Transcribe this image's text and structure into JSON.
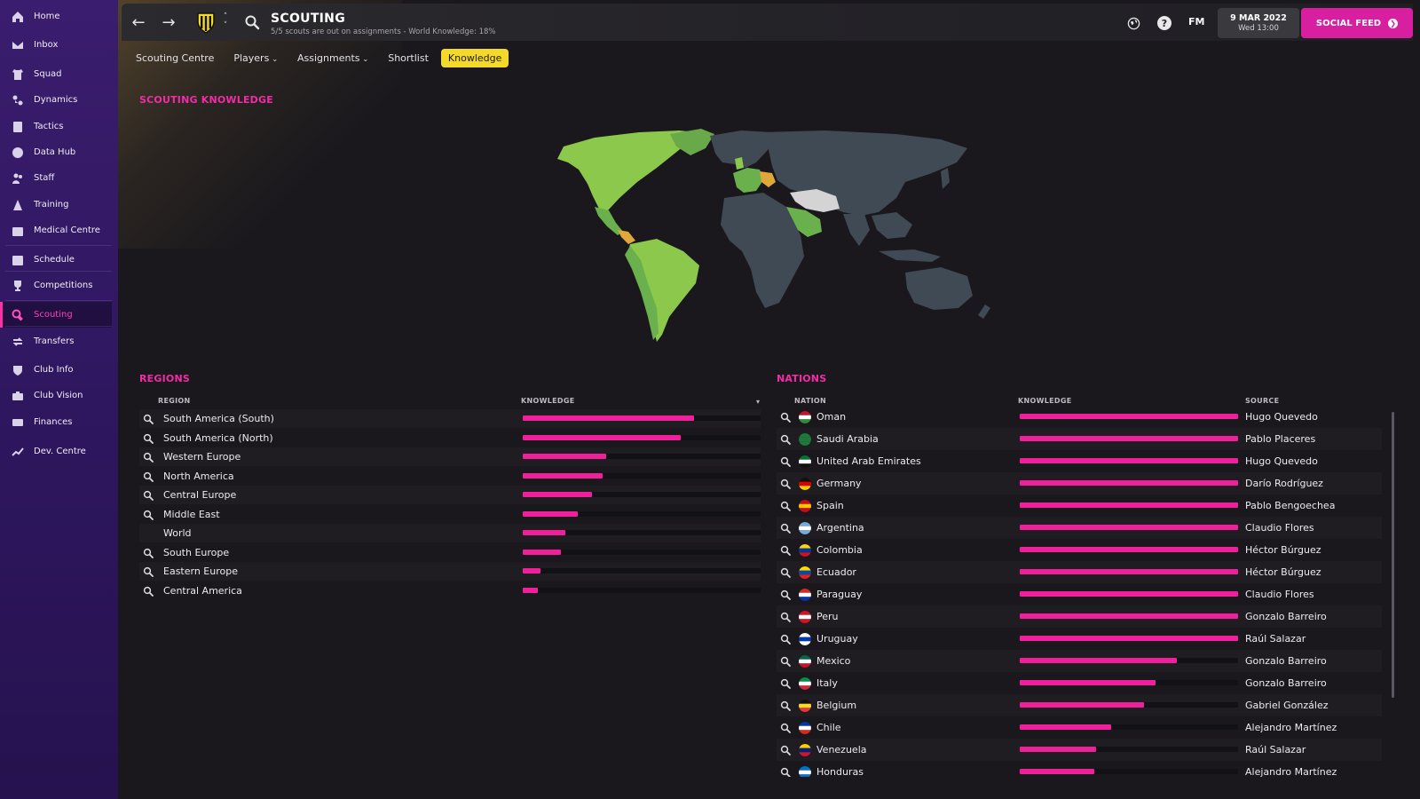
{
  "sidebar": {
    "items": [
      {
        "label": "Home",
        "icon": "home-icon"
      },
      {
        "label": "Inbox",
        "icon": "inbox-icon"
      },
      {
        "label": "Squad",
        "icon": "shirt-icon"
      },
      {
        "label": "Dynamics",
        "icon": "dynamics-icon"
      },
      {
        "label": "Tactics",
        "icon": "tactics-board-icon"
      },
      {
        "label": "Data Hub",
        "icon": "data-hub-icon"
      },
      {
        "label": "Staff",
        "icon": "staff-icon"
      },
      {
        "label": "Training",
        "icon": "training-cone-icon"
      },
      {
        "label": "Medical Centre",
        "icon": "medical-kit-icon"
      },
      {
        "label": "Schedule",
        "icon": "calendar-icon"
      },
      {
        "label": "Competitions",
        "icon": "trophy-icon"
      },
      {
        "label": "Scouting",
        "icon": "search-icon"
      },
      {
        "label": "Transfers",
        "icon": "transfer-arrows-icon"
      },
      {
        "label": "Club Info",
        "icon": "shield-icon"
      },
      {
        "label": "Club Vision",
        "icon": "vision-icon"
      },
      {
        "label": "Finances",
        "icon": "finances-icon"
      },
      {
        "label": "Dev. Centre",
        "icon": "dev-centre-icon"
      }
    ],
    "active": "Scouting"
  },
  "header": {
    "title": "SCOUTING",
    "subtitle": "5/5 scouts are out on assignments - World Knowledge: 18%",
    "fm_label": "FM",
    "date": "9 MAR 2022",
    "day_time": "Wed 13:00",
    "social_feed": "SOCIAL FEED"
  },
  "tabs": [
    {
      "label": "Scouting Centre",
      "dropdown": false
    },
    {
      "label": "Players",
      "dropdown": true
    },
    {
      "label": "Assignments",
      "dropdown": true
    },
    {
      "label": "Shortlist",
      "dropdown": false
    },
    {
      "label": "Knowledge",
      "dropdown": false,
      "active": true
    }
  ],
  "scouting_knowledge_title": "SCOUTING KNOWLEDGE",
  "regions": {
    "title": "REGIONS",
    "col_region": "REGION",
    "col_knowledge": "KNOWLEDGE",
    "rows": [
      {
        "name": "South America (South)",
        "knowledge": 0.72,
        "searchable": true
      },
      {
        "name": "South America (North)",
        "knowledge": 0.665,
        "searchable": true
      },
      {
        "name": "Western Europe",
        "knowledge": 0.35,
        "searchable": true
      },
      {
        "name": "North America",
        "knowledge": 0.335,
        "searchable": true
      },
      {
        "name": "Central Europe",
        "knowledge": 0.29,
        "searchable": true
      },
      {
        "name": "Middle East",
        "knowledge": 0.23,
        "searchable": true
      },
      {
        "name": "World",
        "knowledge": 0.18,
        "searchable": false
      },
      {
        "name": "South Europe",
        "knowledge": 0.16,
        "searchable": true
      },
      {
        "name": "Eastern Europe",
        "knowledge": 0.075,
        "searchable": true
      },
      {
        "name": "Central America",
        "knowledge": 0.065,
        "searchable": true
      }
    ]
  },
  "nations": {
    "title": "NATIONS",
    "col_nation": "NATION",
    "col_knowledge": "KNOWLEDGE",
    "col_source": "SOURCE",
    "rows": [
      {
        "name": "Oman",
        "knowledge": 1.0,
        "source": "Hugo Quevedo",
        "flag": [
          "#c8102e",
          "#ffffff",
          "#2e8b3a"
        ]
      },
      {
        "name": "Saudi Arabia",
        "knowledge": 1.0,
        "source": "Pablo Placeres",
        "flag": [
          "#1f7a3a",
          "#1f7a3a",
          "#1f7a3a"
        ]
      },
      {
        "name": "United Arab Emirates",
        "knowledge": 1.0,
        "source": "Hugo Quevedo",
        "flag": [
          "#00732f",
          "#ffffff",
          "#111111"
        ]
      },
      {
        "name": "Germany",
        "knowledge": 1.0,
        "source": "Darío Rodríguez",
        "flag": [
          "#111111",
          "#dd0000",
          "#ffce00"
        ]
      },
      {
        "name": "Spain",
        "knowledge": 1.0,
        "source": "Pablo Bengoechea",
        "flag": [
          "#c60b1e",
          "#ffc400",
          "#c60b1e"
        ]
      },
      {
        "name": "Argentina",
        "knowledge": 1.0,
        "source": "Claudio Flores",
        "flag": [
          "#75aadb",
          "#ffffff",
          "#75aadb"
        ]
      },
      {
        "name": "Colombia",
        "knowledge": 1.0,
        "source": "Héctor Búrguez",
        "flag": [
          "#fcd116",
          "#003893",
          "#ce1126"
        ]
      },
      {
        "name": "Ecuador",
        "knowledge": 1.0,
        "source": "Héctor Búrguez",
        "flag": [
          "#ffdd00",
          "#034ea2",
          "#ed1c24"
        ]
      },
      {
        "name": "Paraguay",
        "knowledge": 1.0,
        "source": "Claudio Flores",
        "flag": [
          "#d52b1e",
          "#ffffff",
          "#0038a8"
        ]
      },
      {
        "name": "Peru",
        "knowledge": 1.0,
        "source": "Gonzalo Barreiro",
        "flag": [
          "#d91023",
          "#ffffff",
          "#d91023"
        ]
      },
      {
        "name": "Uruguay",
        "knowledge": 1.0,
        "source": "Raúl Salazar",
        "flag": [
          "#ffffff",
          "#0038a8",
          "#ffffff"
        ]
      },
      {
        "name": "Mexico",
        "knowledge": 0.72,
        "source": "Gonzalo Barreiro",
        "flag": [
          "#006847",
          "#ffffff",
          "#ce1126"
        ]
      },
      {
        "name": "Italy",
        "knowledge": 0.62,
        "source": "Gonzalo Barreiro",
        "flag": [
          "#009246",
          "#ffffff",
          "#ce2b37"
        ]
      },
      {
        "name": "Belgium",
        "knowledge": 0.57,
        "source": "Gabriel González",
        "flag": [
          "#111111",
          "#fdda24",
          "#ef3340"
        ]
      },
      {
        "name": "Chile",
        "knowledge": 0.42,
        "source": "Alejandro Martínez",
        "flag": [
          "#0039a6",
          "#ffffff",
          "#d52b1e"
        ]
      },
      {
        "name": "Venezuela",
        "knowledge": 0.35,
        "source": "Raúl Salazar",
        "flag": [
          "#ffcc00",
          "#00247d",
          "#cf142b"
        ]
      },
      {
        "name": "Honduras",
        "knowledge": 0.34,
        "source": "Alejandro Martínez",
        "flag": [
          "#0073cf",
          "#ffffff",
          "#0073cf"
        ]
      }
    ]
  },
  "colors": {
    "accent_pink": "#f0209c",
    "tab_active": "#f5d928",
    "map_high": "#8cc84b",
    "map_mid": "#6ab04c",
    "map_partial": "#e0a83a",
    "map_unknown": "#3f4a55",
    "map_assigned": "#d4d4d4"
  }
}
